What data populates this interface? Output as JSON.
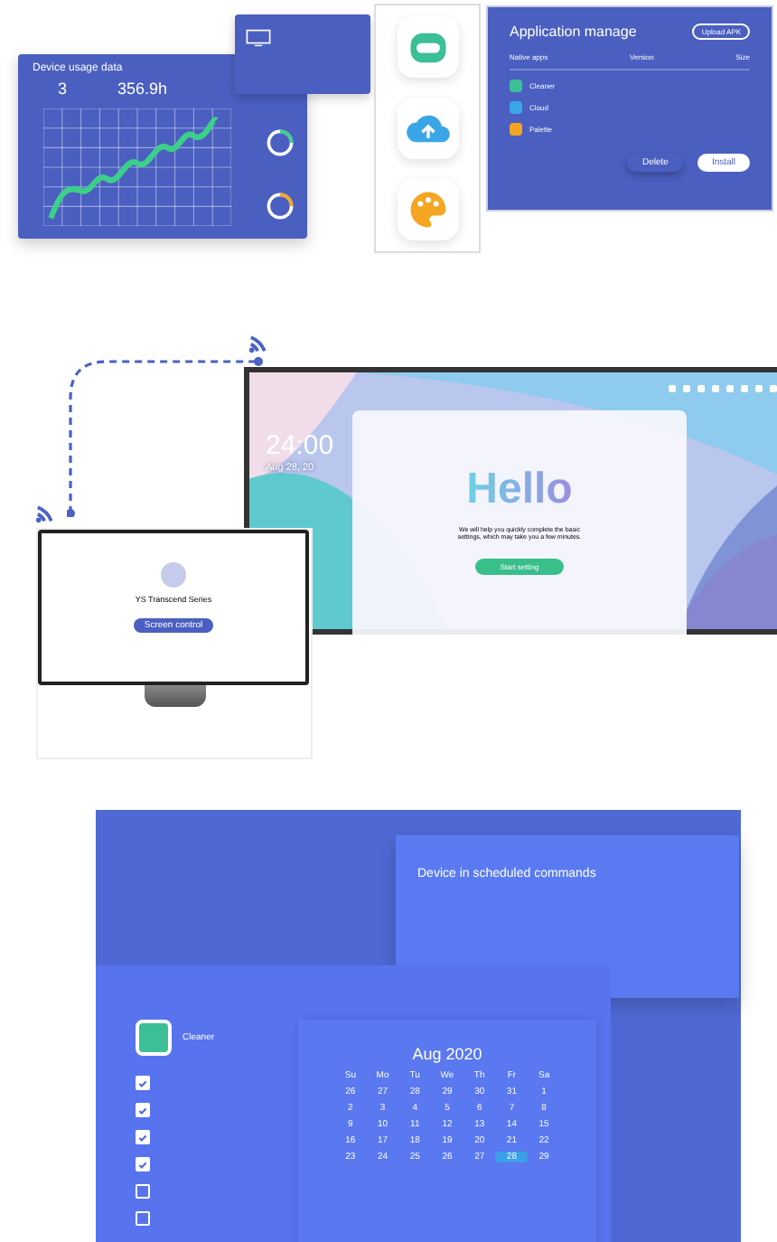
{
  "usage_card": {
    "title": "Device usage data",
    "stats": [
      "3",
      "356.9h"
    ]
  },
  "app_icons": [
    {
      "kind": "robot"
    },
    {
      "kind": "cloud"
    },
    {
      "kind": "palette"
    }
  ],
  "app_manage": {
    "title": "Application manage",
    "upload": "Upload APK",
    "columns": [
      "Native apps",
      "Version",
      "Size"
    ],
    "apps": [
      {
        "kind": "robot",
        "name": "Cleaner"
      },
      {
        "kind": "cloud",
        "name": "Cloud"
      },
      {
        "kind": "palette",
        "name": "Palette"
      }
    ],
    "buttons": [
      "Delete",
      "Install"
    ]
  },
  "display": {
    "time": "24:00",
    "date": "Aug 28, 20",
    "greeting": "Hello",
    "message": "We will help you quickly complete the basic settings, which may take you a few minutes.",
    "button": "Start setting"
  },
  "monitor": {
    "title": "YS Transcend Series",
    "button": "Screen control"
  },
  "schedule": {
    "title": "Device in scheduled commands"
  },
  "app_card": {
    "name": "Cleaner",
    "options": [
      {
        "checked": true
      },
      {
        "checked": true
      },
      {
        "checked": true
      },
      {
        "checked": true
      },
      {
        "checked": false
      },
      {
        "checked": false
      }
    ]
  },
  "calendar": {
    "month": "Aug 2020",
    "weekdays": [
      "Su",
      "Mo",
      "Tu",
      "We",
      "Th",
      "Fr",
      "Sa"
    ],
    "days": [
      {
        "label": "26",
        "selected": false
      },
      {
        "label": "27",
        "selected": false
      },
      {
        "label": "28",
        "selected": false
      },
      {
        "label": "29",
        "selected": false
      },
      {
        "label": "30",
        "selected": false
      },
      {
        "label": "31",
        "selected": false
      },
      {
        "label": "1",
        "selected": false
      },
      {
        "label": "2",
        "selected": false
      },
      {
        "label": "3",
        "selected": false
      },
      {
        "label": "4",
        "selected": false
      },
      {
        "label": "5",
        "selected": false
      },
      {
        "label": "6",
        "selected": false
      },
      {
        "label": "7",
        "selected": false
      },
      {
        "label": "8",
        "selected": false
      },
      {
        "label": "9",
        "selected": false
      },
      {
        "label": "10",
        "selected": false
      },
      {
        "label": "11",
        "selected": false
      },
      {
        "label": "12",
        "selected": false
      },
      {
        "label": "13",
        "selected": false
      },
      {
        "label": "14",
        "selected": false
      },
      {
        "label": "15",
        "selected": false
      },
      {
        "label": "16",
        "selected": false
      },
      {
        "label": "17",
        "selected": false
      },
      {
        "label": "18",
        "selected": false
      },
      {
        "label": "19",
        "selected": false
      },
      {
        "label": "20",
        "selected": false
      },
      {
        "label": "21",
        "selected": false
      },
      {
        "label": "22",
        "selected": false
      },
      {
        "label": "23",
        "selected": false
      },
      {
        "label": "24",
        "selected": false
      },
      {
        "label": "25",
        "selected": false
      },
      {
        "label": "26",
        "selected": false
      },
      {
        "label": "27",
        "selected": false
      },
      {
        "label": "28",
        "selected": true
      },
      {
        "label": "29",
        "selected": false
      }
    ]
  }
}
